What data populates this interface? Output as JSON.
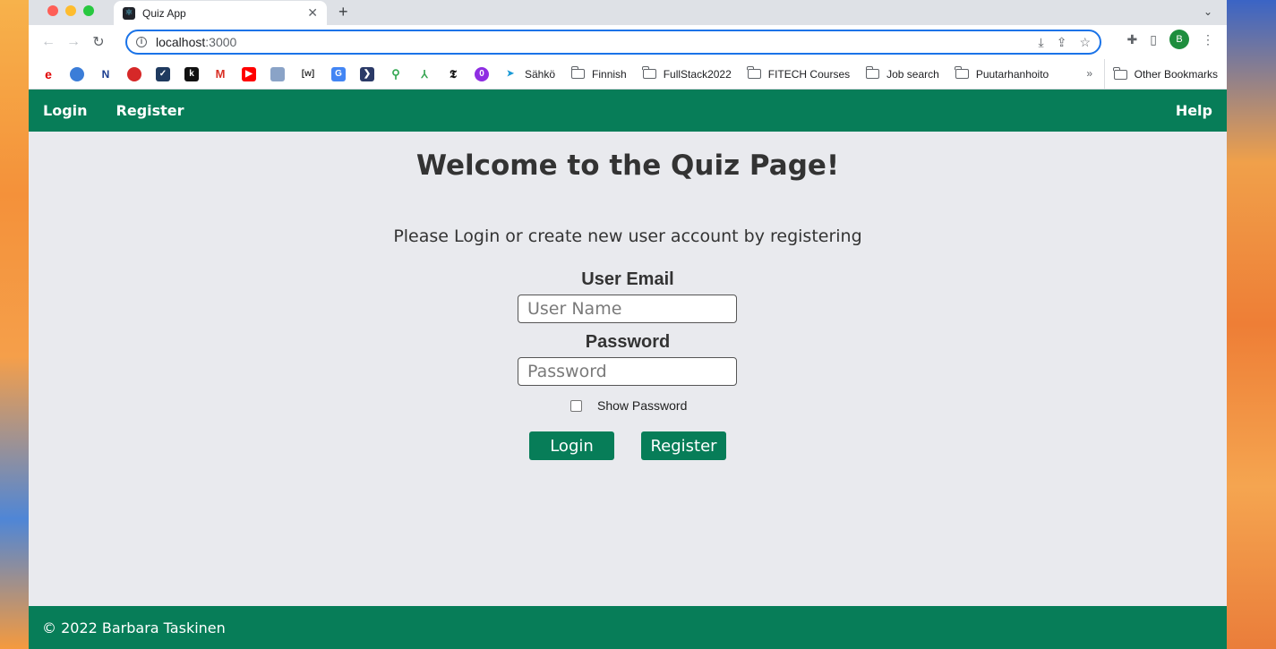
{
  "browser": {
    "tab_title": "Quiz App",
    "tab_favicon": "react-icon",
    "url_host": "localhost",
    "url_port": ":3000",
    "profile_initial": "B"
  },
  "bookmarks": {
    "icons": [
      "e",
      "N",
      "k",
      "M",
      "[w]"
    ],
    "folders": [
      "Sähkö",
      "Finnish",
      "FullStack2022",
      "FITECH Courses",
      "Job search",
      "Puutarhanhoito"
    ],
    "more": "»",
    "other": "Other Bookmarks"
  },
  "nav": {
    "login": "Login",
    "register": "Register",
    "help": "Help"
  },
  "main": {
    "title": "Welcome to the Quiz Page!",
    "subtitle": "Please Login or create new user account by registering",
    "email_label": "User Email",
    "email_placeholder": "User Name",
    "password_label": "Password",
    "password_placeholder": "Password",
    "show_password": "Show Password",
    "login_button": "Login",
    "register_button": "Register"
  },
  "footer": {
    "text": "© 2022 Barbara Taskinen"
  },
  "colors": {
    "brand_green": "#077d58",
    "page_bg": "#e9eaee"
  }
}
